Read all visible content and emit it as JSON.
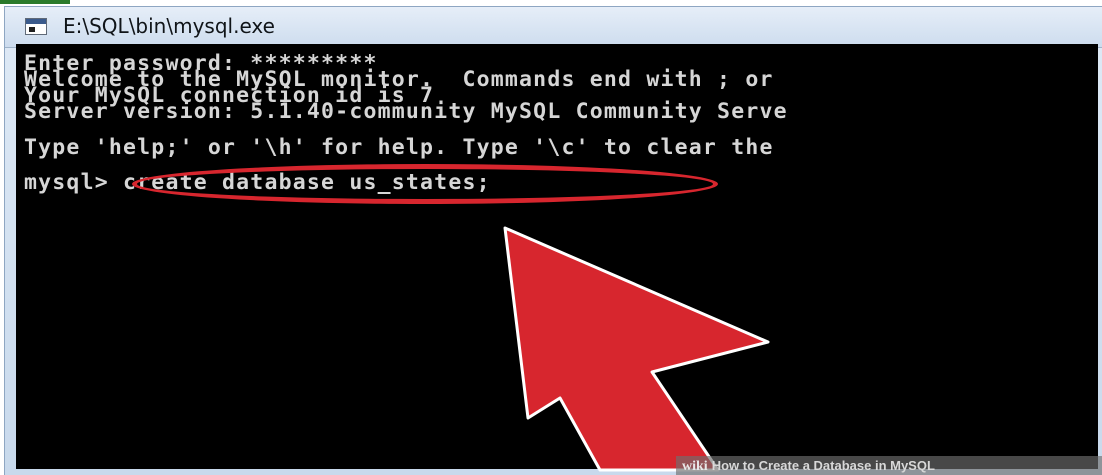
{
  "window": {
    "title": "E:\\SQL\\bin\\mysql.exe",
    "icon": "console-window-icon"
  },
  "console": {
    "lines": [
      "Enter password: *********",
      "Welcome to the MySQL monitor.  Commands end with ; or",
      "Your MySQL connection id is 7",
      "Server version: 5.1.40-community MySQL Community Serve",
      "Type 'help;' or '\\h' for help. Type '\\c' to clear the",
      "mysql> create database us_states;"
    ]
  },
  "annotation": {
    "highlight_color": "#d7262e",
    "arrow_color": "#d7262e",
    "arrow_outline": "#ffffff"
  },
  "watermark": {
    "brand": "wiki",
    "text": "How to Create a Database in MySQL"
  }
}
